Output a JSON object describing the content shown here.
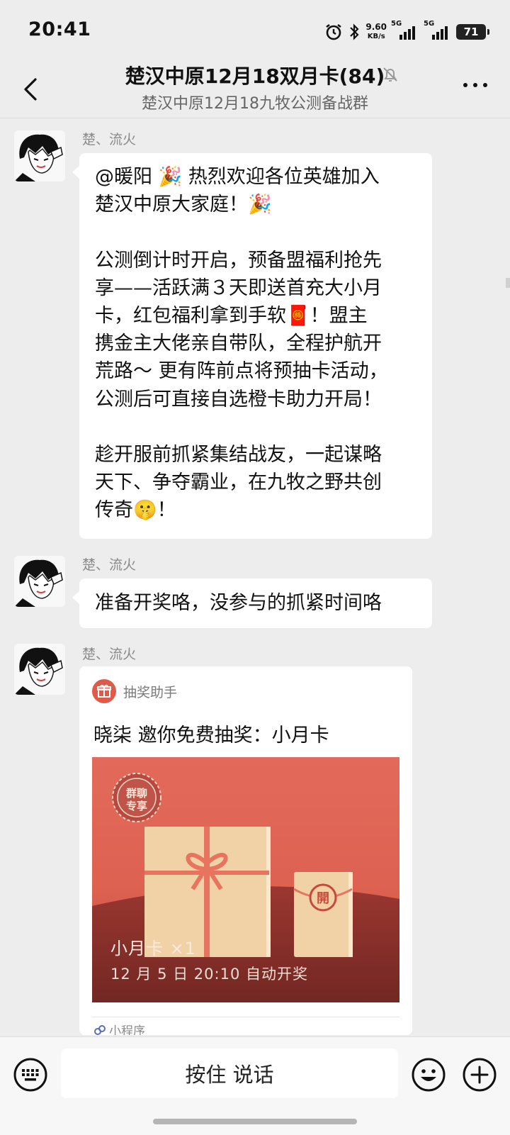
{
  "status_bar": {
    "time": "20:41",
    "net_speed_value": "9.60",
    "net_speed_unit": "KB/s",
    "signal1_label": "5G",
    "signal2_label": "5G",
    "battery": "71"
  },
  "header": {
    "title": "楚汉中原12月18双月卡(84)",
    "subtitle": "楚汉中原12月18九牧公测备战群"
  },
  "messages": [
    {
      "sender": "楚、流火",
      "text_lines": [
        "@暖阳 🎉 热烈欢迎各位英雄加入",
        "楚汉中原大家庭！🎉",
        "",
        "公测倒计时开启，预备盟福利抢先",
        "享——活跃满３天即送首充大小月",
        "卡，红包福利拿到手软🧧！盟主",
        "携金主大佬亲自带队，全程护航开",
        "荒路～ 更有阵前点将预抽卡活动，",
        "公测后可直接自选橙卡助力开局！",
        "",
        "趁开服前抓紧集结战友，一起谋略",
        "天下、争夺霸业，在九牧之野共创",
        "传奇🤫！"
      ]
    },
    {
      "sender": "楚、流火",
      "text_lines": [
        "准备开奖咯，没参与的抓紧时间咯"
      ]
    },
    {
      "sender": "楚、流火",
      "card": {
        "app_name": "抽奖助手",
        "title": "晓柒 邀你免费抽奖：小月卡",
        "badge_line1": "群聊",
        "badge_line2": "专享",
        "open_char": "開",
        "prize": "小月卡 ×1",
        "draw_time": "12 月 5 日 20:10 自动开奖",
        "footer": "小程序"
      }
    }
  ],
  "input_bar": {
    "hold_to_talk": "按住 说话"
  },
  "icons": {
    "back": "chevron-left-icon",
    "mute": "bell-off-icon",
    "more": "more-dots-icon",
    "keyboard": "keyboard-icon",
    "emoji": "smile-icon",
    "plus": "plus-circle-icon"
  },
  "colors": {
    "bg": "#ededed",
    "card_red": "#e26a5a",
    "app_icon_red": "#e05a4a"
  }
}
